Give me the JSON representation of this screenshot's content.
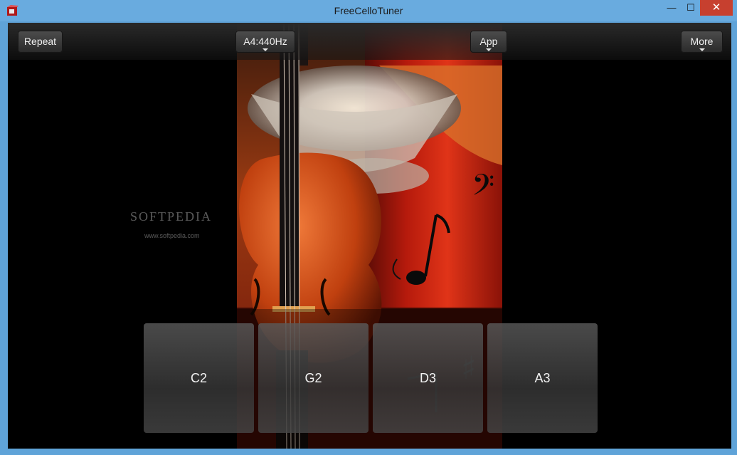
{
  "window": {
    "title": "FreeCelloTuner",
    "controls": {
      "minimize": "—",
      "maximize": "☐",
      "close": "✕"
    }
  },
  "toolbar": {
    "repeat_label": "Repeat",
    "pitch_label": "A4:440Hz",
    "app_label": "App",
    "more_label": "More"
  },
  "strings": [
    {
      "label": "C2"
    },
    {
      "label": "G2"
    },
    {
      "label": "D3"
    },
    {
      "label": "A3"
    }
  ],
  "background": {
    "watermark": "SOFTPEDIA",
    "watermark_url": "www.softpedia.com"
  },
  "colors": {
    "titlebar": "#69abdf",
    "close_button": "#c7402f",
    "canvas": "#000000",
    "cello": "#c9461b",
    "curtain": "#b01010"
  }
}
